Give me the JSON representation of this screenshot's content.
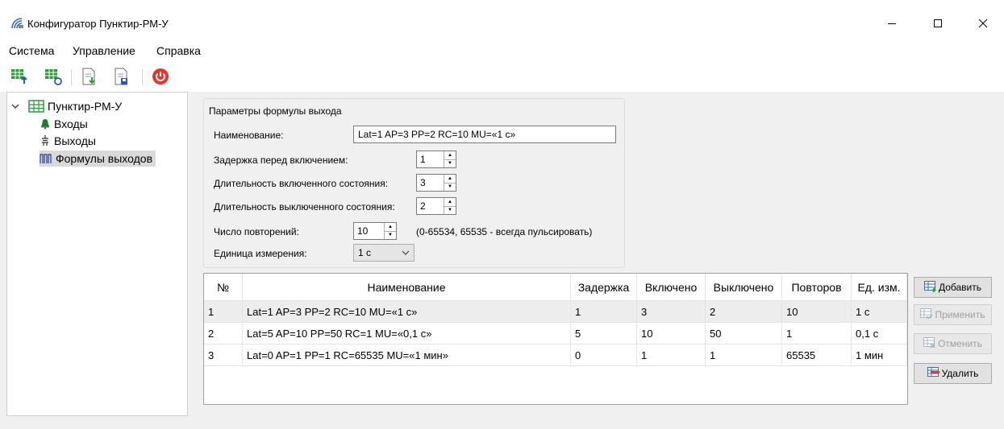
{
  "window": {
    "title": "Конфигуратор Пунктир-РМ-У",
    "controls": {
      "minimize": "—",
      "maximize": "☐",
      "close": "✕"
    }
  },
  "menu": [
    "Система",
    "Управление",
    "Справка"
  ],
  "toolbar": {
    "buttons": [
      "upload-device-icon",
      "read-device-icon",
      "import-file-icon",
      "save-file-icon",
      "power-icon"
    ],
    "accent": "#e8342b"
  },
  "tree": {
    "root": "Пунктир-РМ-У",
    "items": [
      "Входы",
      "Выходы",
      "Формулы выходов"
    ],
    "selected_index": 2
  },
  "form": {
    "group_title": "Параметры формулы выхода",
    "name_label": "Наименование:",
    "name_value": "Lat=1 AP=3 PP=2 RC=10 MU=«1 с»",
    "delay_label": "Задержка перед включением:",
    "delay_value": "1",
    "on_label": "Длительность включенного состояния:",
    "on_value": "3",
    "off_label": "Длительность выключенного состояния:",
    "off_value": "2",
    "repeat_label": "Число повторений:",
    "repeat_value": "10",
    "repeat_hint": "(0-65534, 65535 - всегда пульсировать)",
    "unit_label": "Единица измерения:",
    "unit_value": "1 с"
  },
  "table": {
    "columns": [
      "№",
      "Наименование",
      "Задержка",
      "Включено",
      "Выключено",
      "Повторов",
      "Ед. изм."
    ],
    "rows": [
      [
        "1",
        "Lat=1 AP=3 PP=2 RC=10 MU=«1 с»",
        "1",
        "3",
        "2",
        "10",
        "1 с"
      ],
      [
        "2",
        "Lat=5 AP=10 PP=50 RC=1 MU=«0,1 с»",
        "5",
        "10",
        "50",
        "1",
        "0,1 с"
      ],
      [
        "3",
        "Lat=0 AP=1 PP=1 RC=65535 MU=«1 мин»",
        "0",
        "1",
        "1",
        "65535",
        "1 мин"
      ]
    ],
    "selected_row": 0
  },
  "actions": {
    "add": "Добавить",
    "apply": "Применить",
    "cancel": "Отменить",
    "delete": "Удалить"
  }
}
